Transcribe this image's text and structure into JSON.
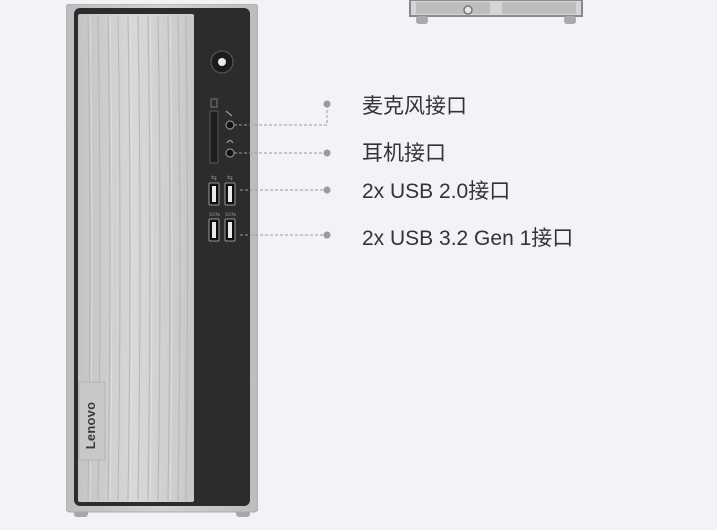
{
  "product": {
    "brand": "Lenovo"
  },
  "ports": [
    {
      "id": "mic",
      "label": "麦克风接口"
    },
    {
      "id": "headphone",
      "label": "耳机接口"
    },
    {
      "id": "usb2",
      "label": "2x USB 2.0接口"
    },
    {
      "id": "usb3",
      "label": "2x USB 3.2 Gen 1接口"
    }
  ],
  "colors": {
    "background": "#f3f2f7",
    "chassis": "#d9d9db",
    "front_panel": "#2b2b2c",
    "bezel": "#c9c9cb",
    "label_text": "#333333",
    "leader_line": "#9a9a9a"
  },
  "icons": [
    "power-button-icon",
    "microphone-icon",
    "headphone-icon",
    "usb-icon"
  ]
}
